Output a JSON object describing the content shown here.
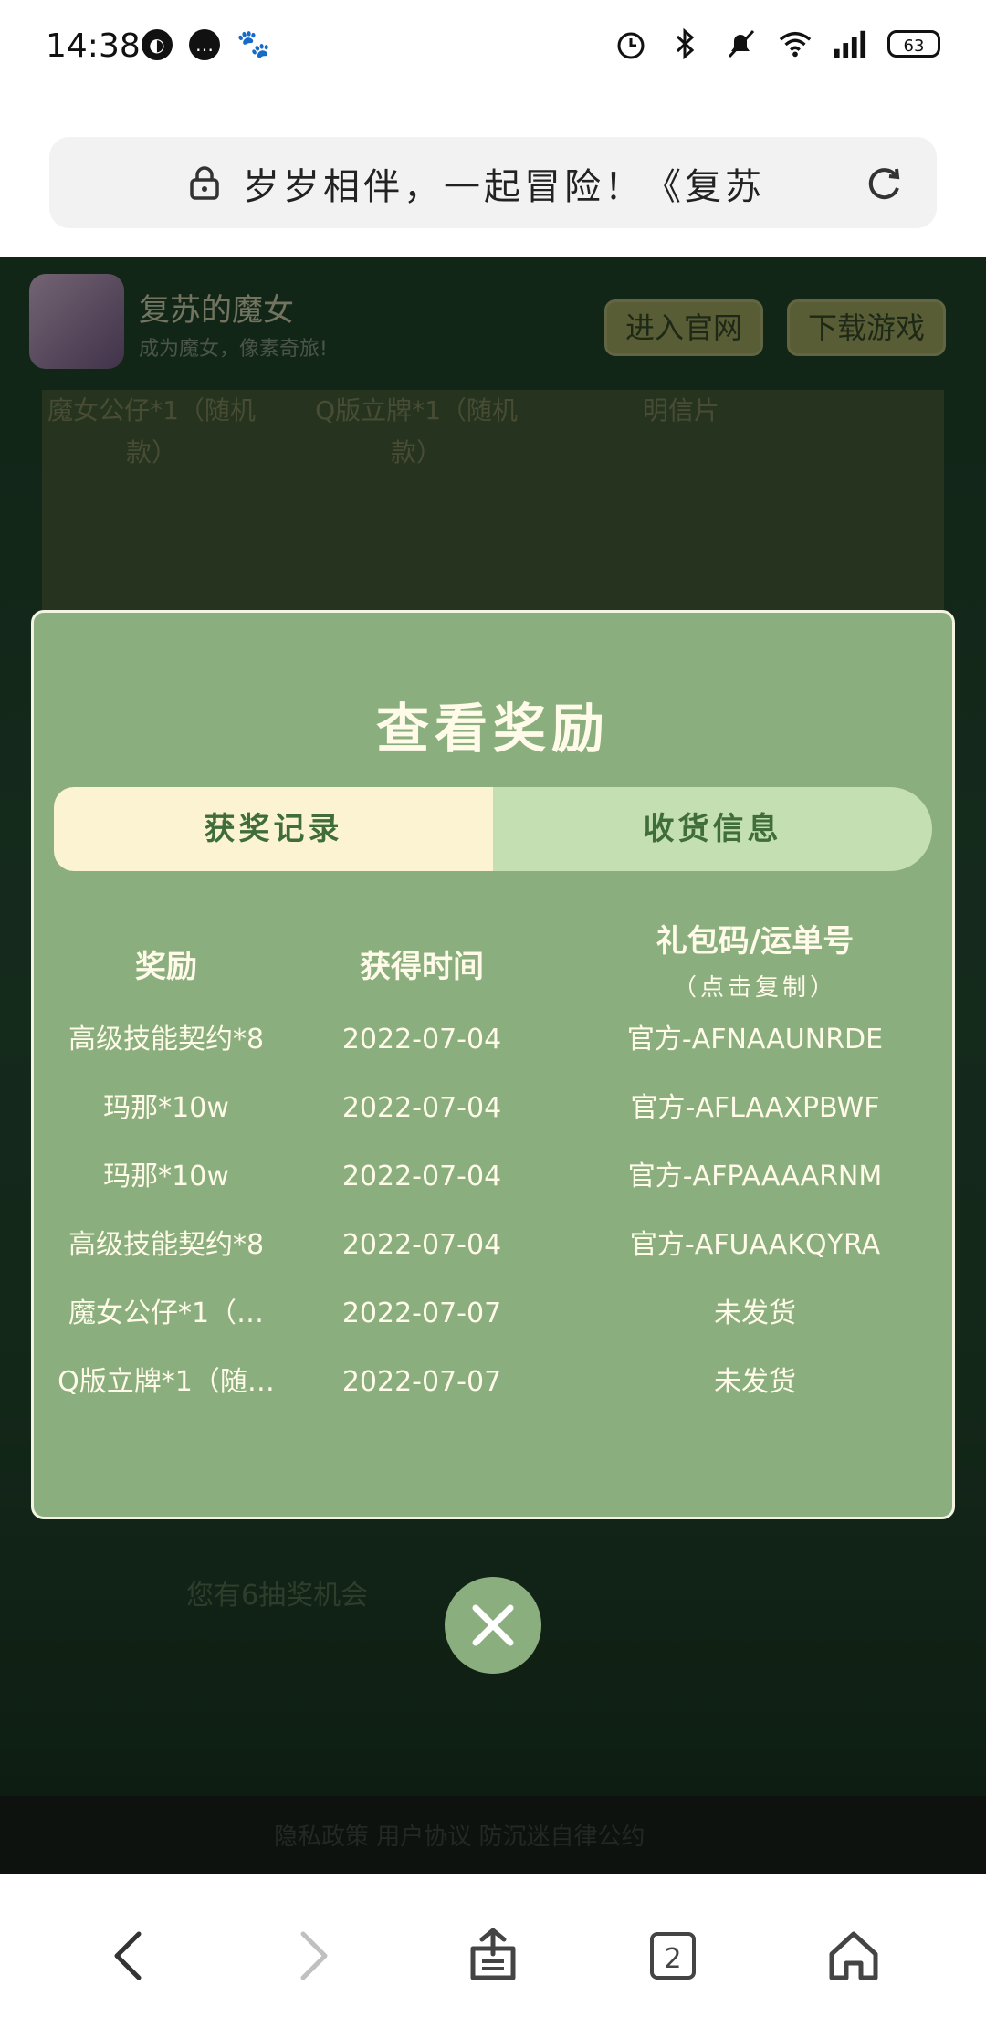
{
  "status_bar": {
    "time": "14:38",
    "battery": "63",
    "icons": [
      "alarm-icon",
      "bluetooth-icon",
      "mute-icon",
      "wifi-icon",
      "signal-icon"
    ]
  },
  "url_bar": {
    "text": "岁岁相伴，一起冒险！《复苏"
  },
  "background_page": {
    "game_name": "复苏的魔女",
    "game_slogan": "成为魔女，像素奇旅!",
    "btn_official": "进入官网",
    "btn_download": "下载游戏",
    "prize_labels": [
      "魔女公仔*1（随机款）",
      "Q版立牌*1（随机款）",
      "明信片"
    ],
    "chances": "您有6抽奖机会",
    "footer": "隐私政策  用户协议  防沉迷自律公约"
  },
  "modal": {
    "title": "查看奖励",
    "tabs": [
      {
        "label": "获奖记录",
        "active": true
      },
      {
        "label": "收货信息",
        "active": false
      }
    ],
    "headers": {
      "reward": "奖励",
      "time": "获得时间",
      "code": "礼包码/运单号",
      "code_hint": "（点击复制）"
    },
    "rows": [
      {
        "reward": "高级技能契约*8",
        "time": "2022-07-04",
        "code": "官方-AFNAAUNRDE"
      },
      {
        "reward": "玛那*10w",
        "time": "2022-07-04",
        "code": "官方-AFLAAXPBWF"
      },
      {
        "reward": "玛那*10w",
        "time": "2022-07-04",
        "code": "官方-AFPAAAARNM"
      },
      {
        "reward": "高级技能契约*8",
        "time": "2022-07-04",
        "code": "官方-AFUAAKQYRA"
      },
      {
        "reward": "魔女公仔*1（…",
        "time": "2022-07-07",
        "code": "未发货"
      },
      {
        "reward": "Q版立牌*1（随…",
        "time": "2022-07-07",
        "code": "未发货"
      }
    ]
  },
  "nav": {
    "tab_count": "2"
  },
  "colors": {
    "modal_bg": "#8aae7e",
    "tab_active": "#fbf3d2",
    "tab_inactive": "#c4dfb1",
    "text_light": "#fffbe8",
    "tab_text": "#3f6e3a"
  }
}
